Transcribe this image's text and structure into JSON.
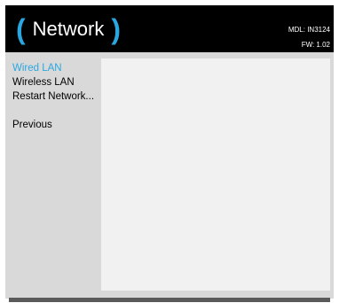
{
  "header": {
    "paren_left": "(",
    "title": "Network",
    "paren_right": ")",
    "model": "MDL: IN3124",
    "firmware": "FW: 1.02"
  },
  "menu": {
    "items": [
      {
        "label": "Wired LAN",
        "selected": true
      },
      {
        "label": "Wireless LAN",
        "selected": false
      },
      {
        "label": "Restart Network...",
        "selected": false
      }
    ],
    "previous_label": "Previous"
  },
  "colors": {
    "accent": "#2aa7e0",
    "header_bg": "#000000",
    "panel_bg": "#d9d9d9",
    "content_bg": "#f1f1f1"
  }
}
